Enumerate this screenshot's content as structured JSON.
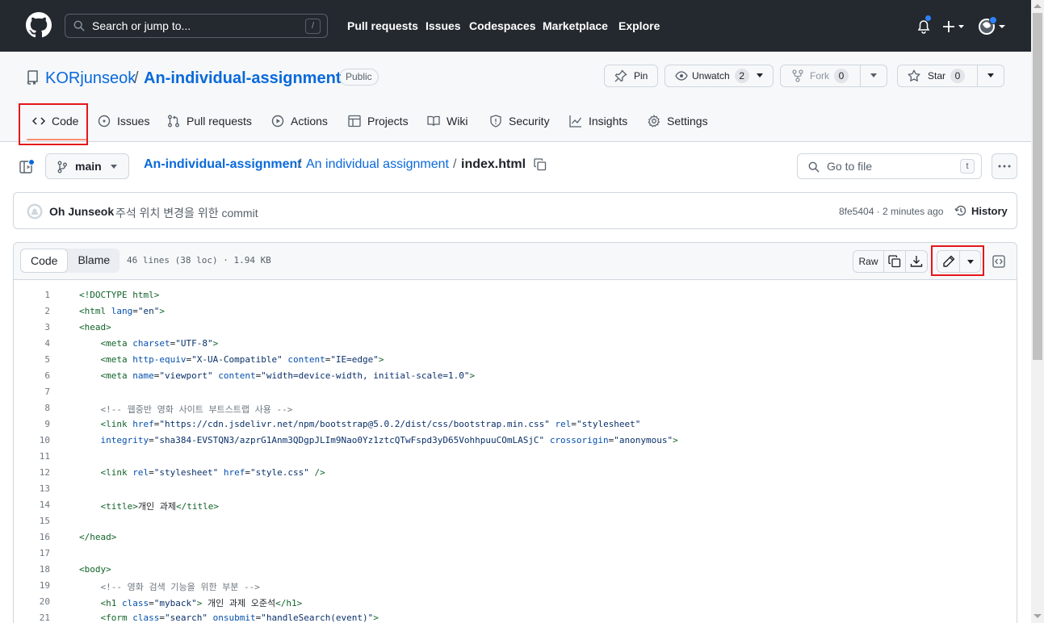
{
  "header": {
    "search_placeholder": "Search or jump to...",
    "search_key": "/",
    "nav": [
      "Pull requests",
      "Issues",
      "Codespaces",
      "Marketplace",
      "Explore"
    ]
  },
  "repo": {
    "owner": "KORjunseok",
    "separator": "/",
    "name": "An-individual-assignment",
    "visibility": "Public",
    "pin_label": "Pin",
    "unwatch_label": "Unwatch",
    "unwatch_count": "2",
    "fork_label": "Fork",
    "fork_count": "0",
    "star_label": "Star",
    "star_count": "0"
  },
  "tabs": {
    "code": "Code",
    "issues": "Issues",
    "pulls": "Pull requests",
    "actions": "Actions",
    "projects": "Projects",
    "wiki": "Wiki",
    "security": "Security",
    "insights": "Insights",
    "settings": "Settings"
  },
  "filenav": {
    "branch": "main",
    "crumb_repo": "An-individual-assignment",
    "crumb_sep1": "/",
    "crumb_folder": "An individual assignment",
    "crumb_sep2": "/",
    "crumb_file": "index.html",
    "goto_placeholder": "Go to file",
    "goto_key": "t"
  },
  "commit": {
    "author": "Oh Junseok",
    "message": "주석 위치 변경을 위한 commit",
    "sha_time": "8fe5404 · 2 minutes ago",
    "history": "History"
  },
  "file": {
    "view_code": "Code",
    "view_blame": "Blame",
    "meta": "46 lines (38 loc) · 1.94 KB",
    "raw": "Raw"
  },
  "code_lines": [
    {
      "n": "1",
      "html": "<span class='tg'>&lt;!DOCTYPE html&gt;</span>"
    },
    {
      "n": "2",
      "html": "<span class='tg'>&lt;html</span> <span class='at'>lang</span>=<span class='sv'>\"en\"</span><span class='tg'>&gt;</span>"
    },
    {
      "n": "3",
      "html": "<span class='tg'>&lt;head&gt;</span>"
    },
    {
      "n": "4",
      "html": "    <span class='tg'>&lt;meta</span> <span class='at'>charset</span>=<span class='sv'>\"UTF-8\"</span><span class='tg'>&gt;</span>"
    },
    {
      "n": "5",
      "html": "    <span class='tg'>&lt;meta</span> <span class='at'>http-equiv</span>=<span class='sv'>\"X-UA-Compatible\"</span> <span class='at'>content</span>=<span class='sv'>\"IE=edge\"</span><span class='tg'>&gt;</span>"
    },
    {
      "n": "6",
      "html": "    <span class='tg'>&lt;meta</span> <span class='at'>name</span>=<span class='sv'>\"viewport\"</span> <span class='at'>content</span>=<span class='sv'>\"width=device-width, initial-scale=1.0\"</span><span class='tg'>&gt;</span>"
    },
    {
      "n": "7",
      "html": ""
    },
    {
      "n": "8",
      "html": "    <span class='cm'>&lt;!-- 웹중반 영화 사이트 부트스트랩 사용 --&gt;</span>"
    },
    {
      "n": "9",
      "html": "    <span class='tg'>&lt;link</span> <span class='at'>href</span>=<span class='sv'>\"https://cdn.jsdelivr.net/npm/bootstrap@5.0.2/dist/css/bootstrap.min.css\"</span> <span class='at'>rel</span>=<span class='sv'>\"stylesheet\"</span>"
    },
    {
      "n": "10",
      "html": "    <span class='at'>integrity</span>=<span class='sv'>\"sha384-EVSTQN3/azprG1Anm3QDgpJLIm9Nao0Yz1ztcQTwFspd3yD65VohhpuuCOmLASjC\"</span> <span class='at'>crossorigin</span>=<span class='sv'>\"anonymous\"</span><span class='tg'>&gt;</span>"
    },
    {
      "n": "11",
      "html": ""
    },
    {
      "n": "12",
      "html": "    <span class='tg'>&lt;link</span> <span class='at'>rel</span>=<span class='sv'>\"stylesheet\"</span> <span class='at'>href</span>=<span class='sv'>\"style.css\"</span> <span class='tg'>/&gt;</span>"
    },
    {
      "n": "13",
      "html": ""
    },
    {
      "n": "14",
      "html": "    <span class='tg'>&lt;title&gt;</span>개인 과제<span class='tg'>&lt;/title&gt;</span>"
    },
    {
      "n": "15",
      "html": ""
    },
    {
      "n": "16",
      "html": "<span class='tg'>&lt;/head&gt;</span>"
    },
    {
      "n": "17",
      "html": ""
    },
    {
      "n": "18",
      "html": "<span class='tg'>&lt;body&gt;</span>"
    },
    {
      "n": "19",
      "html": "    <span class='cm'>&lt;!-- 영화 검색 기능을 위한 부분 --&gt;</span>"
    },
    {
      "n": "20",
      "html": "    <span class='tg'>&lt;h1</span> <span class='at'>class</span>=<span class='sv'>\"myback\"</span><span class='tg'>&gt;</span> 개인 과제 오준석<span class='tg'>&lt;/h1&gt;</span>"
    },
    {
      "n": "21",
      "html": "    <span class='tg'>&lt;form</span> <span class='at'>class</span>=<span class='sv'>\"search\"</span> <span class='at'>onsubmit</span>=<span class='sv'>\"handleSearch(event)\"</span><span class='tg'>&gt;</span>"
    }
  ]
}
